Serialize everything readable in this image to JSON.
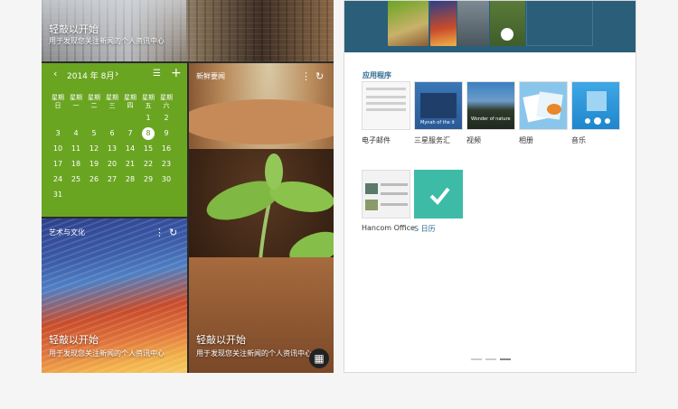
{
  "left_screen": {
    "top_tile": {
      "title": "轻敲以开始",
      "subtitle": "用于发现您关注新闻的个人资讯中心"
    },
    "calendar": {
      "month_label": "2014 年 8月",
      "prev": "‹",
      "next": "›",
      "list_icon": "☰",
      "add_icon": "+",
      "weekdays": [
        {
          "l1": "星期",
          "l2": "日"
        },
        {
          "l1": "星期",
          "l2": "一"
        },
        {
          "l1": "星期",
          "l2": "二"
        },
        {
          "l1": "星期",
          "l2": "三"
        },
        {
          "l1": "星期",
          "l2": "四"
        },
        {
          "l1": "星期",
          "l2": "五"
        },
        {
          "l1": "星期",
          "l2": "六"
        }
      ],
      "days": [
        [
          "",
          "",
          "",
          "",
          "",
          "1",
          "2"
        ],
        [
          "3",
          "4",
          "5",
          "6",
          "7",
          "8",
          "9"
        ],
        [
          "10",
          "11",
          "12",
          "13",
          "14",
          "15",
          "16"
        ],
        [
          "17",
          "18",
          "19",
          "20",
          "21",
          "22",
          "23"
        ],
        [
          "24",
          "25",
          "26",
          "27",
          "28",
          "29",
          "30"
        ],
        [
          "31",
          "",
          "",
          "",
          "",
          "",
          ""
        ]
      ],
      "selected_day": "8"
    },
    "news_tile": {
      "label": "新鲜要闻",
      "title": "轻敲以开始",
      "subtitle": "用于发现您关注新闻的个人资讯中心"
    },
    "art_tile": {
      "label": "艺术与文化",
      "title": "轻敲以开始",
      "subtitle": "用于发现您关注新闻的个人资讯中心"
    },
    "kebab_glyph": "⋮",
    "refresh_glyph": "↻",
    "apps_glyph": "▦"
  },
  "right_screen": {
    "section_title": "应用程序",
    "apps": [
      {
        "label": "电子邮件",
        "icon": "email-app-icon"
      },
      {
        "label": "三星服务汇",
        "icon": "samsung-hub-app-icon"
      },
      {
        "label": "视频",
        "icon": "video-app-icon"
      },
      {
        "label": "相册",
        "icon": "gallery-app-icon"
      },
      {
        "label": "音乐",
        "icon": "music-app-icon"
      },
      {
        "label": "Hancom Office",
        "icon": "hancom-office-app-icon"
      },
      {
        "label": "S 日历",
        "icon": "s-calendar-app-icon"
      }
    ],
    "hub_tiles": [
      "Mynah of the it",
      "Wonder of nature"
    ]
  },
  "colors": {
    "calendar_green": "#6aa522",
    "tablet_header": "#2b5e78",
    "accent_blue": "#2e6b8e",
    "s_calendar_teal": "#3dbba7"
  }
}
